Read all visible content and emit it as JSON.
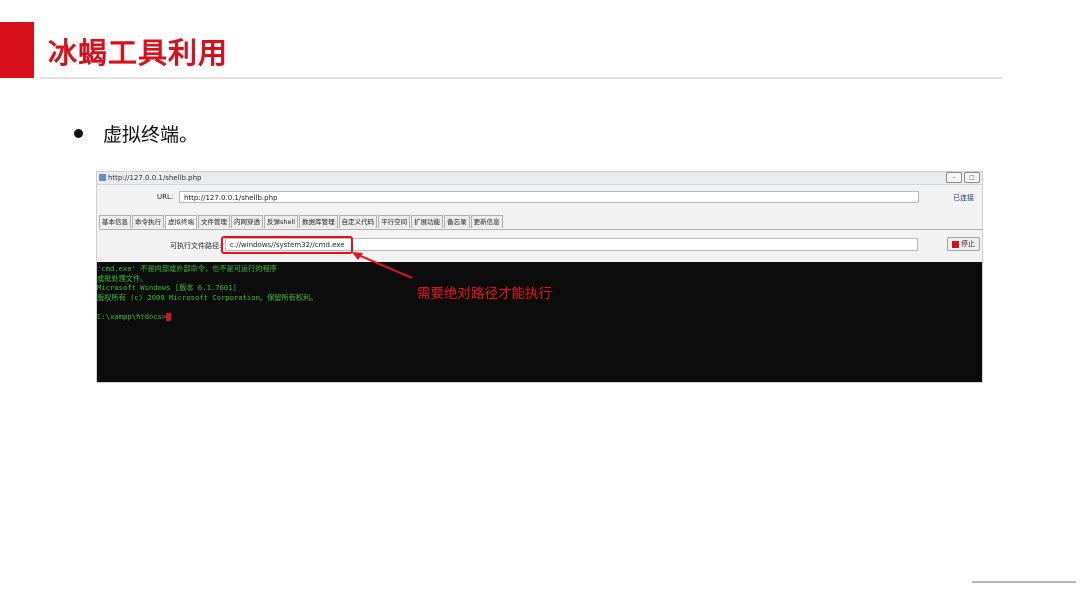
{
  "slide": {
    "title": "冰蝎工具利用",
    "bullet": "虚拟终端。"
  },
  "window": {
    "title": "http://127.0.0.1/shellb.php",
    "minimize_label": "–",
    "restore_label": "□"
  },
  "url_bar": {
    "label": "URL:",
    "value": "http://127.0.0.1/shellb.php",
    "status": "已连接"
  },
  "tabs": [
    {
      "label": "基本信息",
      "active": false
    },
    {
      "label": "命令执行",
      "active": false
    },
    {
      "label": "虚拟终端",
      "active": true
    },
    {
      "label": "文件管理",
      "active": false
    },
    {
      "label": "内网穿透",
      "active": false
    },
    {
      "label": "反弹shell",
      "active": false
    },
    {
      "label": "数据库管理",
      "active": false
    },
    {
      "label": "自定义代码",
      "active": false
    },
    {
      "label": "平行空间",
      "active": false
    },
    {
      "label": "扩展功能",
      "active": false
    },
    {
      "label": "备忘录",
      "active": false
    },
    {
      "label": "更新信息",
      "active": false
    }
  ],
  "exec_path": {
    "label": "可执行文件路径:",
    "value": "c://windows//system32//cmd.exe",
    "stop_label": "停止"
  },
  "terminal": {
    "lines": [
      "'cmd.exe' 不是内部或外部命令，也不是可运行的程序",
      "或批处理文件。",
      "Microsoft Windows [版本 6.1.7601]",
      "版权所有 (c) 2009 Microsoft Corporation。保留所有权利。",
      "",
      "C:\\xampp\\htdocs>"
    ]
  },
  "annotation": {
    "text": "需要绝对路径才能执行"
  },
  "colors": {
    "accent": "#d8101c",
    "terminal_bg": "#0c0c0c",
    "terminal_fg": "#2ec22e",
    "annotation": "#e8101c"
  }
}
